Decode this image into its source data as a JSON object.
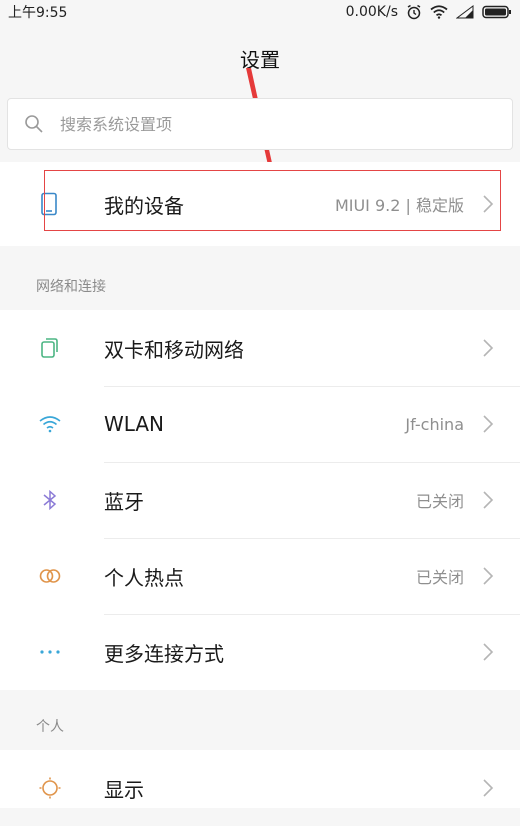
{
  "status_bar": {
    "time": "上午9:55",
    "speed": "0.00K/s"
  },
  "header": {
    "title": "设置"
  },
  "search": {
    "placeholder": "搜索系统设置项"
  },
  "device": {
    "label": "我的设备",
    "value": "MIUI 9.2 | 稳定版"
  },
  "sections": {
    "network": "网络和连接",
    "personal": "个人"
  },
  "network_items": [
    {
      "label": "双卡和移动网络",
      "value": ""
    },
    {
      "label": "WLAN",
      "value": "Jf-china"
    },
    {
      "label": "蓝牙",
      "value": "已关闭"
    },
    {
      "label": "个人热点",
      "value": "已关闭"
    },
    {
      "label": "更多连接方式",
      "value": ""
    }
  ],
  "personal_items": [
    {
      "label": "显示",
      "value": ""
    }
  ],
  "colors": {
    "highlight_box": "#e44545",
    "arrow": "#e53a3a",
    "sim_icon": "#4cb584",
    "wifi_icon": "#3aa7d8",
    "bluetooth_icon": "#8b7bd6",
    "hotspot_icon": "#e0944a",
    "more_icon": "#3aa7d8",
    "display_icon": "#e0944a",
    "device_icon": "#3a88c8"
  }
}
